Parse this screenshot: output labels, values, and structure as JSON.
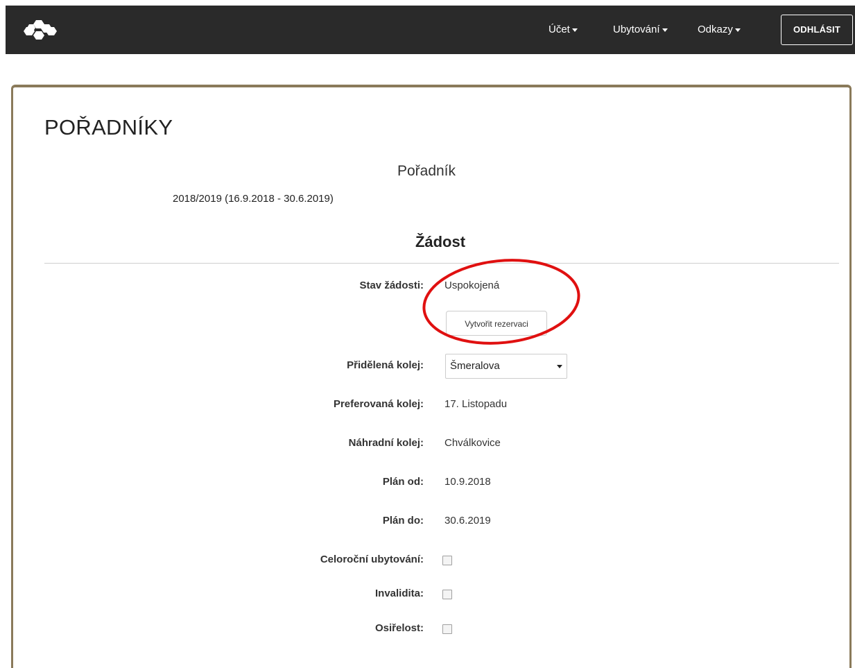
{
  "navbar": {
    "logo_icon": "hexagon-cluster-logo",
    "items": [
      {
        "label": "Účet"
      },
      {
        "label": "Ubytování"
      },
      {
        "label": "Odkazy"
      }
    ],
    "logout_label": "ODHLÁSIT",
    "background": "#2a2a2a"
  },
  "page": {
    "title": "POŘADNÍKY",
    "subtitle": "Pořadník",
    "period": "2018/2019 (16.9.2018 - 30.6.2019)",
    "section_title": "Žádost",
    "panel_border_color": "#8a7a5a"
  },
  "form": {
    "status_label": "Stav žádosti:",
    "status_value": "Uspokojená",
    "reserve_button": "Vytvořit rezervaci",
    "assigned_label": "Přidělená kolej:",
    "assigned_value": "Šmeralova",
    "preferred_label": "Preferovaná kolej:",
    "preferred_value": "17. Listopadu",
    "alternate_label": "Náhradní kolej:",
    "alternate_value": "Chválkovice",
    "plan_from_label": "Plán od:",
    "plan_from_value": "10.9.2018",
    "plan_to_label": "Plán do:",
    "plan_to_value": "30.6.2019",
    "yearround_label": "Celoroční ubytování:",
    "yearround_checked": false,
    "disability_label": "Invalidita:",
    "disability_checked": false,
    "orphan_label": "Osiřelost:",
    "orphan_checked": false
  },
  "annotation": {
    "shape": "ellipse",
    "color": "#e01010"
  }
}
